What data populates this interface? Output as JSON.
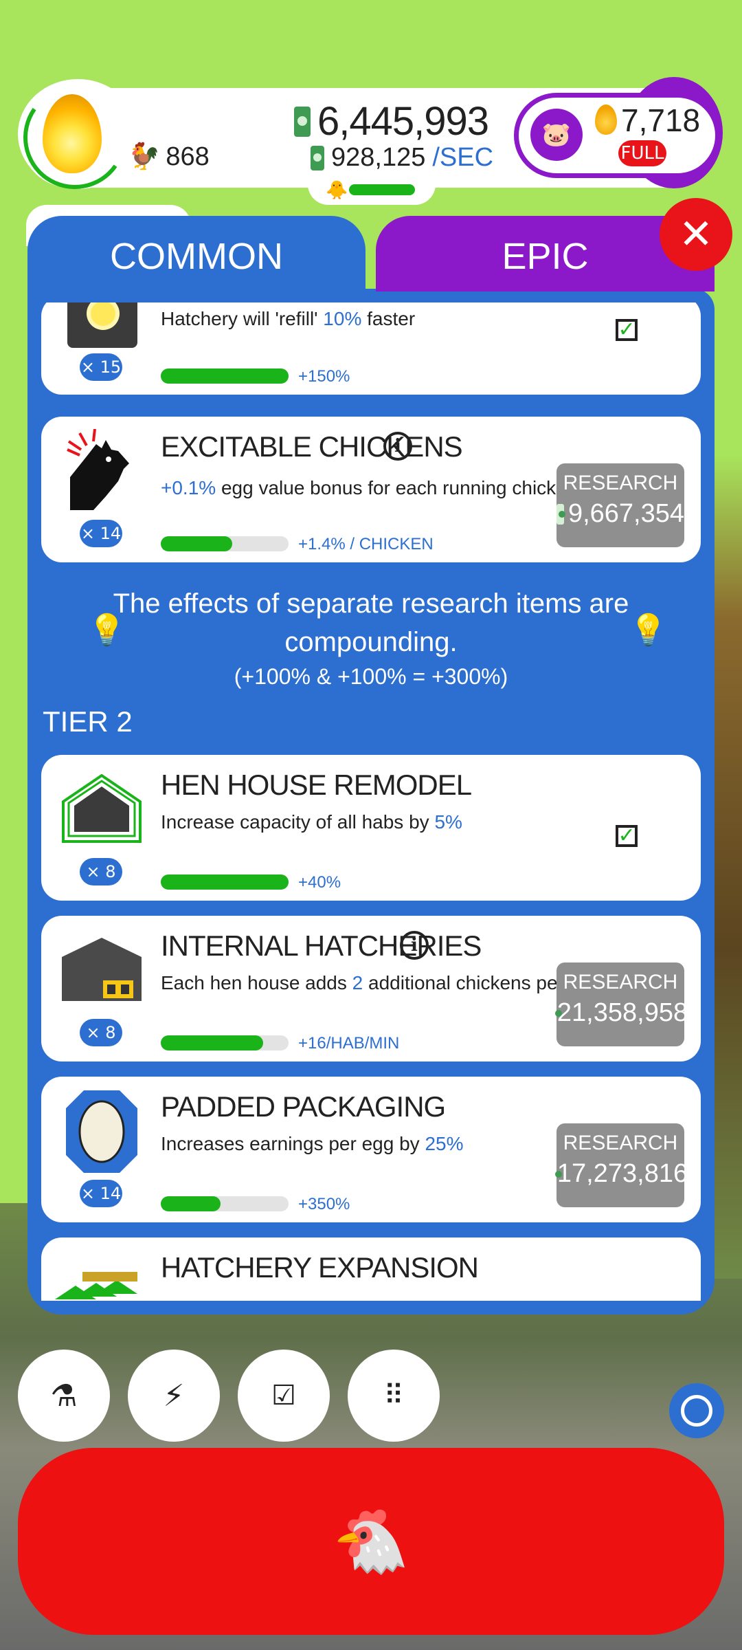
{
  "hud": {
    "chicken_count": "868",
    "money": "6,445,993",
    "rate_value": "928,125",
    "rate_unit": "/SEC",
    "golden_eggs": "7,718",
    "piggy_status": "FULL"
  },
  "tabs": {
    "common": "COMMON",
    "epic": "EPIC"
  },
  "research": {
    "items": [
      {
        "title": "",
        "desc_pre": "Hatchery will 'refill' ",
        "desc_hl": "10%",
        "desc_post": " faster",
        "level": "× 15",
        "bar_label": "+150%",
        "progress": 1.0,
        "completed": true,
        "icon": "hatchery-icon"
      },
      {
        "title": "EXCITABLE CHICKENS",
        "desc_pre": "",
        "desc_hl": "+0.1%",
        "desc_post": " egg value bonus for each running chicken",
        "level": "× 14",
        "bar_label": "+1.4% / CHICKEN",
        "progress": 0.56,
        "completed": false,
        "research_label": "RESEARCH",
        "price": "9,667,354",
        "icon": "excited-chicken-icon"
      },
      {
        "title": "HEN HOUSE REMODEL",
        "desc_pre": "Increase capacity of all habs by ",
        "desc_hl": "5%",
        "desc_post": "",
        "level": "× 8",
        "bar_label": "+40%",
        "progress": 1.0,
        "completed": true,
        "icon": "hen-house-icon"
      },
      {
        "title": "INTERNAL HATCHERIES",
        "desc_pre": "Each hen house adds ",
        "desc_hl": "2",
        "desc_post": " additional chickens per minute",
        "level": "× 8",
        "bar_label": "+16/HAB/MIN",
        "progress": 0.8,
        "completed": false,
        "research_label": "RESEARCH",
        "price": "21,358,958",
        "icon": "internal-hatchery-icon"
      },
      {
        "title": "PADDED PACKAGING",
        "desc_pre": "Increases earnings per egg by ",
        "desc_hl": "25%",
        "desc_post": "",
        "level": "× 14",
        "bar_label": "+350%",
        "progress": 0.47,
        "completed": false,
        "research_label": "RESEARCH",
        "price": "17,273,816",
        "icon": "padded-packaging-icon"
      },
      {
        "title": "HATCHERY EXPANSION",
        "icon": "hatchery-expansion-icon"
      }
    ],
    "tip_line1": "The effects of separate research items are",
    "tip_line2": "compounding.",
    "tip_line3": "(+100% & +100% = +300%)",
    "tier_label": "TIER 2"
  },
  "colors": {
    "panel_blue": "#2c6fd1",
    "epic_purple": "#8b18c9",
    "accent_red": "#ee1111",
    "progress_green": "#1ab31a",
    "background_green": "#a8e55c"
  }
}
